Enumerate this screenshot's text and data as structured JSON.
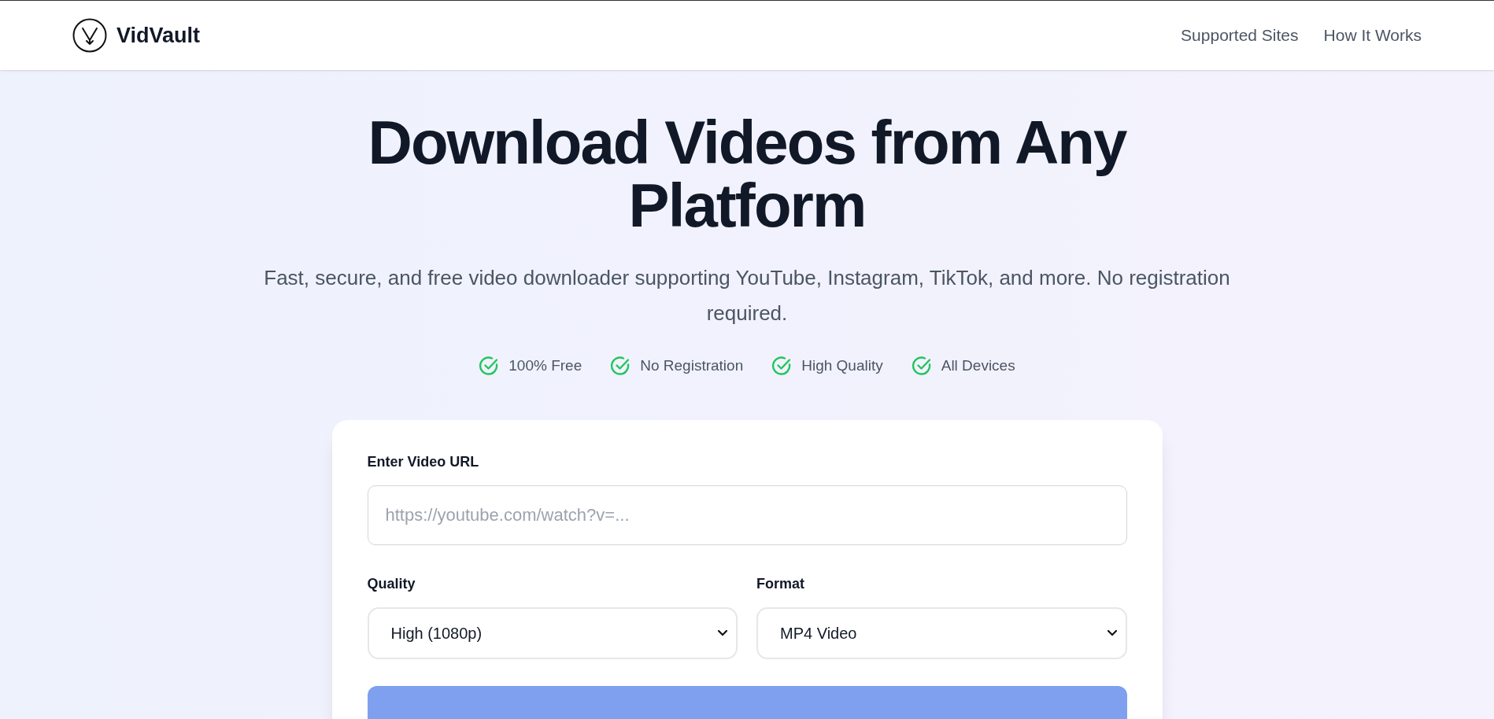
{
  "header": {
    "brand": "VidVault",
    "nav": [
      "Supported Sites",
      "How It Works"
    ]
  },
  "hero": {
    "title": "Download Videos from Any Platform",
    "subtitle": "Fast, secure, and free video downloader supporting YouTube, Instagram, TikTok, and more. No registration required.",
    "features": [
      "100% Free",
      "No Registration",
      "High Quality",
      "All Devices"
    ]
  },
  "form": {
    "url_label": "Enter Video URL",
    "url_placeholder": "https://youtube.com/watch?v=...",
    "selects": [
      {
        "label": "Quality",
        "value": "High (1080p)"
      },
      {
        "label": "Format",
        "value": "MP4 Video"
      }
    ]
  }
}
